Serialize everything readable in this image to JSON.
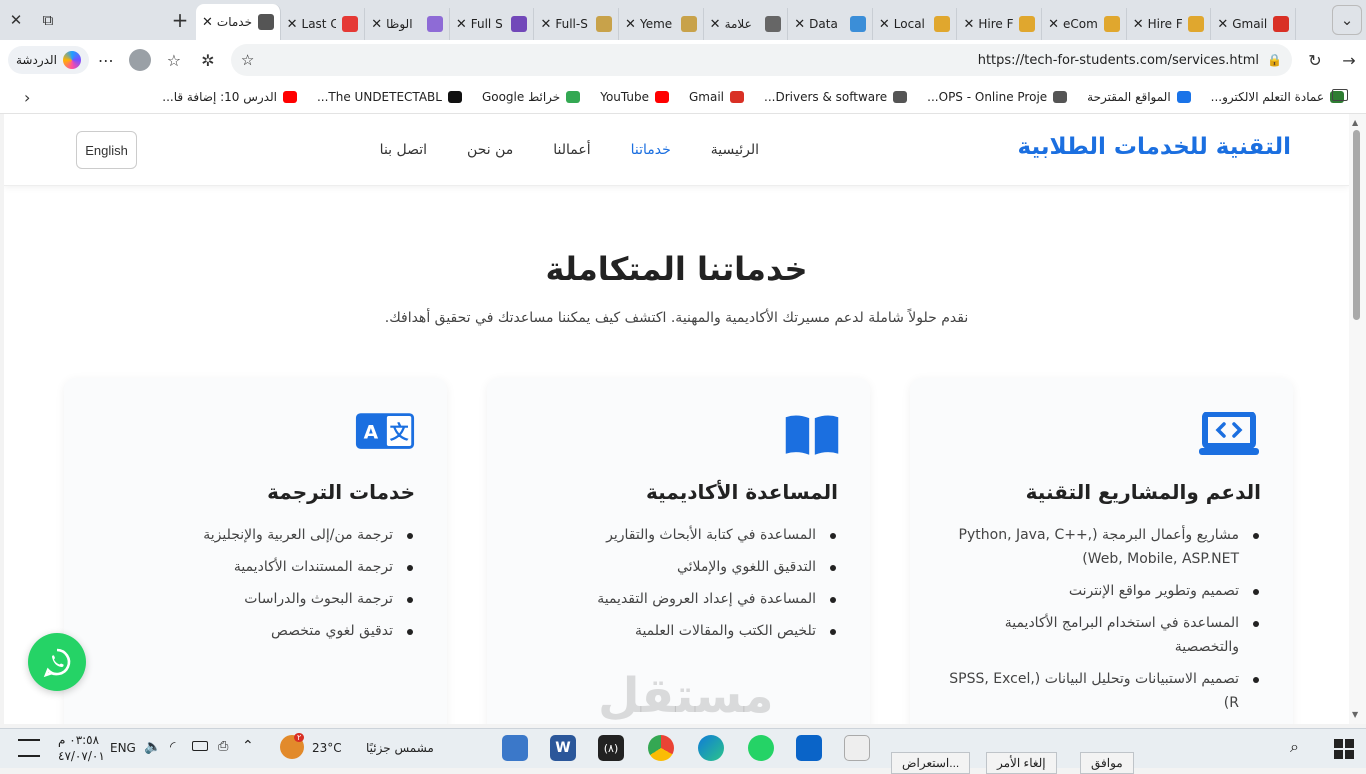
{
  "browser": {
    "tabs": [
      {
        "label": "خدمات",
        "active": true,
        "favicon": "globe-icon"
      },
      {
        "label": "Last C",
        "favicon": "pdf-icon"
      },
      {
        "label": "الوظا",
        "favicon": "hire-icon"
      },
      {
        "label": "Full S",
        "favicon": "forms-icon"
      },
      {
        "label": "Full-S",
        "favicon": "hr-icon"
      },
      {
        "label": "Yeme",
        "favicon": "hr-icon"
      },
      {
        "label": "علامة",
        "favicon": "doc-icon"
      },
      {
        "label": "Data",
        "favicon": "is-icon"
      },
      {
        "label": "Local",
        "favicon": "star-icon"
      },
      {
        "label": "Hire F",
        "favicon": "star-icon"
      },
      {
        "label": "eCom",
        "favicon": "star-icon"
      },
      {
        "label": "Hire F",
        "favicon": "star-icon"
      },
      {
        "label": "Gmail",
        "favicon": "gmail-icon"
      }
    ],
    "copilot_label": "الدردشة",
    "url": "https://tech-for-students.com/services.html",
    "bookmarks": [
      {
        "label": "عمادة التعلم الالكترو...",
        "color": "#2e7d32"
      },
      {
        "label": "المواقع المقترحة",
        "color": "#1a73e8"
      },
      {
        "label": "OPS - Online Proje...",
        "color": "#555555"
      },
      {
        "label": "Drivers & software...",
        "color": "#555555"
      },
      {
        "label": "Gmail",
        "color": "#d93025"
      },
      {
        "label": "YouTube",
        "color": "#ff0000"
      },
      {
        "label": "خرائط Google",
        "color": "#34a853"
      },
      {
        "label": "The UNDETECTABL...",
        "color": "#111111"
      },
      {
        "label": "الدرس 10: إضافة قا...",
        "color": "#ff0000"
      }
    ]
  },
  "site": {
    "brand": "التقنية للخدمات الطلابية",
    "nav": [
      "الرئيسية",
      "خدماتنا",
      "أعمالنا",
      "من نحن",
      "اتصل بنا"
    ],
    "active_nav": "خدماتنا",
    "language_button": "English",
    "hero_title": "خدماتنا المتكاملة",
    "hero_subtitle": "نقدم حلولاً شاملة لدعم مسيرتك الأكاديمية والمهنية. اكتشف كيف يمكننا مساعدتك في تحقيق أهدافك.",
    "accent_color": "#1b6fe0",
    "cards": [
      {
        "title": "الدعم والمشاريع التقنية",
        "icon": "laptop-code-icon",
        "items": [
          "مشاريع وأعمال البرمجة (Python, Java, C++, Web, Mobile, ASP.NET)",
          "تصميم وتطوير مواقع الإنترنت",
          "المساعدة في استخدام البرامج الأكاديمية والتخصصية",
          "تصميم الاستبيانات وتحليل البيانات (SPSS, Excel, R)"
        ]
      },
      {
        "title": "المساعدة الأكاديمية",
        "icon": "book-icon",
        "items": [
          "المساعدة في كتابة الأبحاث والتقارير",
          "التدقيق اللغوي والإملائي",
          "المساعدة في إعداد العروض التقديمية",
          "تلخيص الكتب والمقالات العلمية"
        ]
      },
      {
        "title": "خدمات الترجمة",
        "icon": "translate-icon",
        "items": [
          "ترجمة من/إلى العربية والإنجليزية",
          "ترجمة المستندات الأكاديمية",
          "ترجمة البحوث والدراسات",
          "تدقيق لغوي متخصص"
        ]
      }
    ],
    "watermark": "مستقل"
  },
  "taskbar": {
    "time": "٠٣:٥٨ م",
    "date": "٤٧/٠٧/٠١",
    "lang": "ENG",
    "weather_temp": "23°C",
    "weather_text": "مشمس جزئيًا",
    "weather_badge": "٢",
    "word_badge": "(٨)",
    "notification_buttons": [
      "موافق",
      "إلغاء الأمر",
      "استعراض..."
    ]
  }
}
